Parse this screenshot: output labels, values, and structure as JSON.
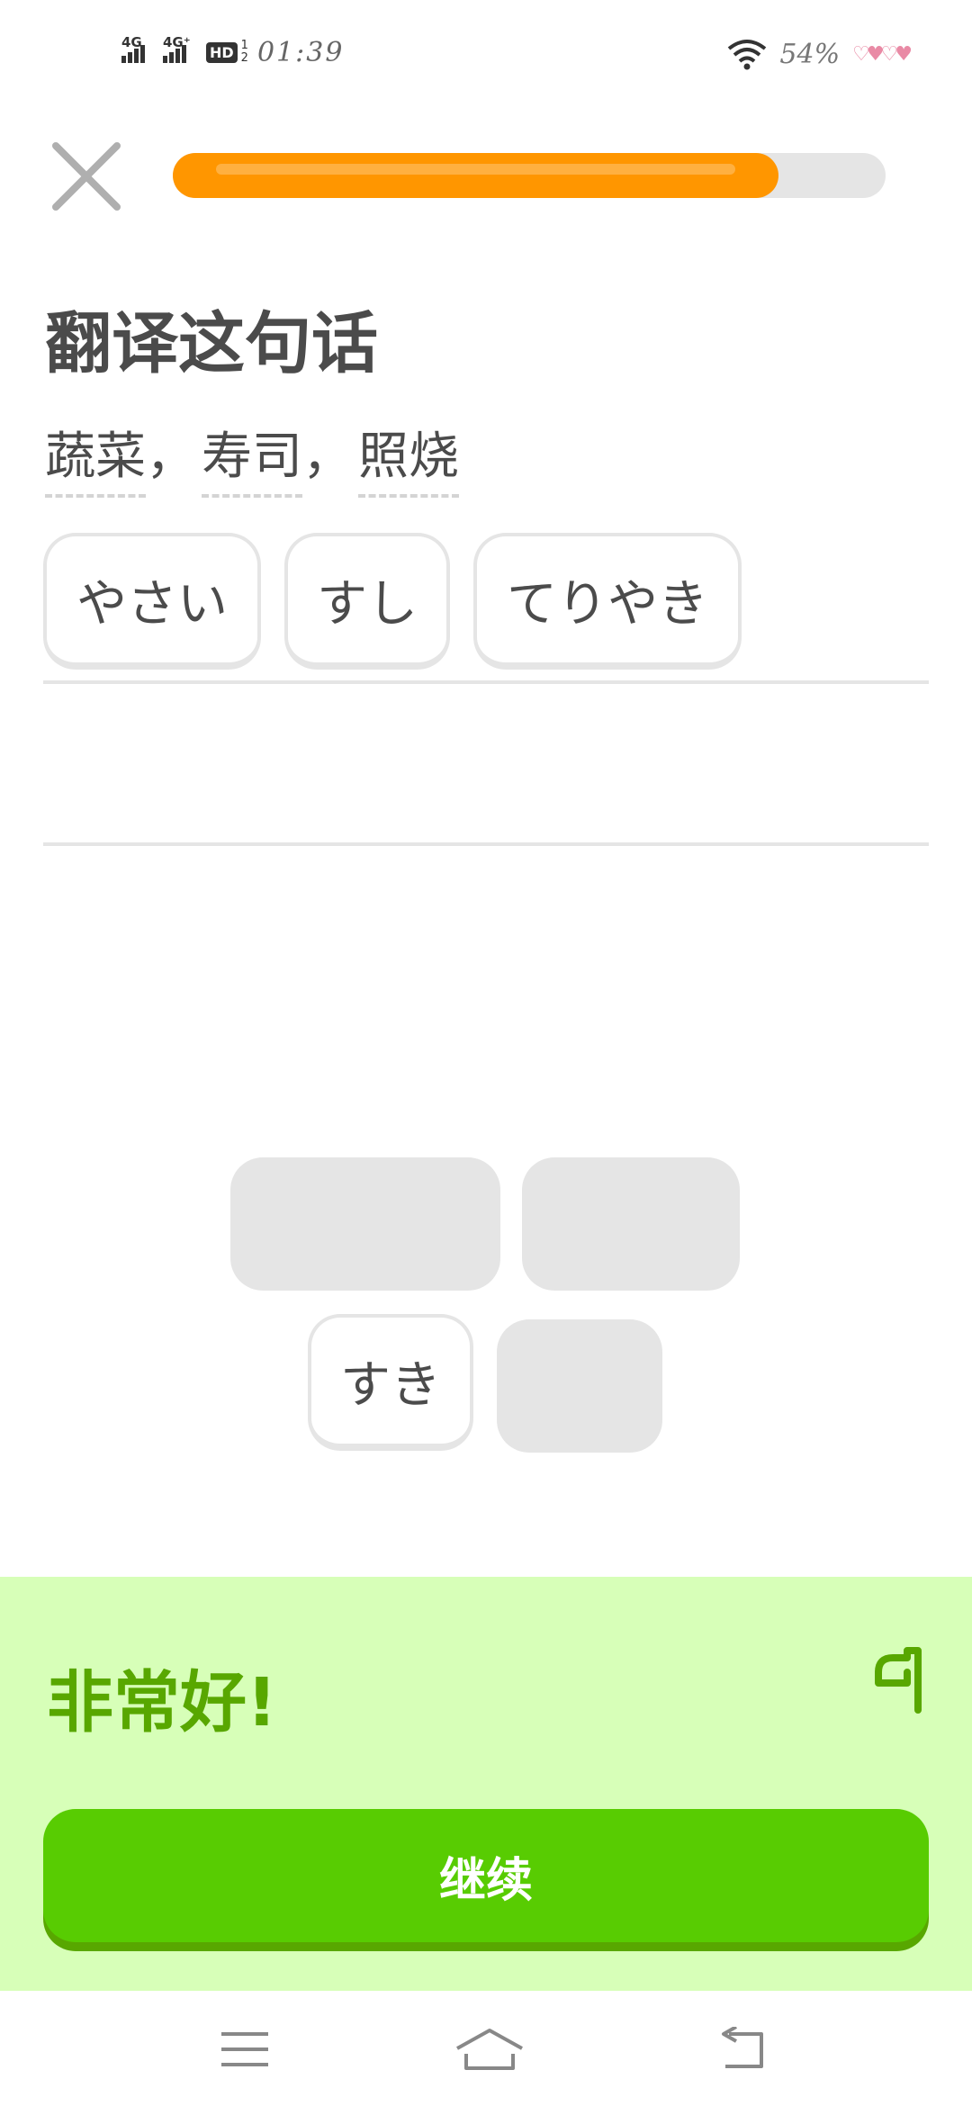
{
  "status_bar": {
    "signal1_label": "4G",
    "signal2_label": "4G⁺",
    "hd_label": "HD",
    "hd_sub1": "1",
    "hd_sub2": "2",
    "time": "01:39",
    "battery": "54%"
  },
  "progress": {
    "fraction": 0.85
  },
  "title": "翻译这句话",
  "prompt": {
    "words": [
      "蔬菜",
      "寿司",
      "照烧"
    ],
    "separator": "，"
  },
  "answer_chips": [
    "やさい",
    "すし",
    "てりやき"
  ],
  "bank_chip": "すき",
  "feedback": {
    "title": "非常好!",
    "continue_label": "继续"
  },
  "colors": {
    "progress": "#ff9600",
    "success_bg": "#d7ffb8",
    "success_text": "#58a700",
    "button": "#58cc02"
  }
}
